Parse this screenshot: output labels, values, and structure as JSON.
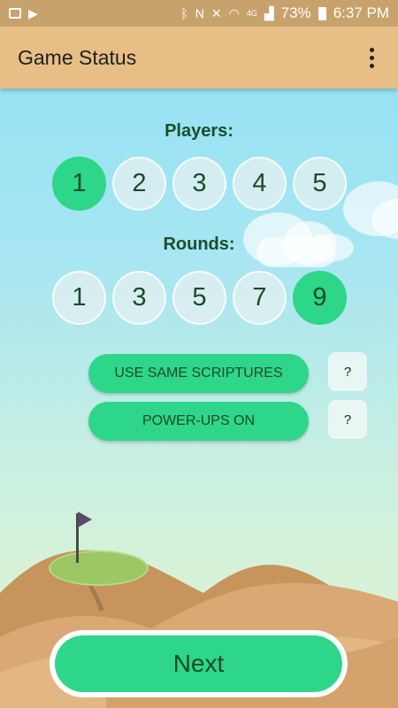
{
  "status_bar": {
    "battery": "73%",
    "time": "6:37 PM",
    "network": "4G"
  },
  "app_bar": {
    "title": "Game Status"
  },
  "players": {
    "label": "Players:",
    "options": [
      "1",
      "2",
      "3",
      "4",
      "5"
    ],
    "selected": "1"
  },
  "rounds": {
    "label": "Rounds:",
    "options": [
      "1",
      "3",
      "5",
      "7",
      "9"
    ],
    "selected": "9"
  },
  "options": {
    "same_scriptures_label": "USE SAME SCRIPTURES",
    "power_ups_label": "POWER-UPS ON",
    "help_label": "?"
  },
  "footer": {
    "next_label": "Next"
  },
  "colors": {
    "accent": "#2ed68a",
    "app_bar": "#e7bf86",
    "text_dark": "#1b4a2a"
  }
}
